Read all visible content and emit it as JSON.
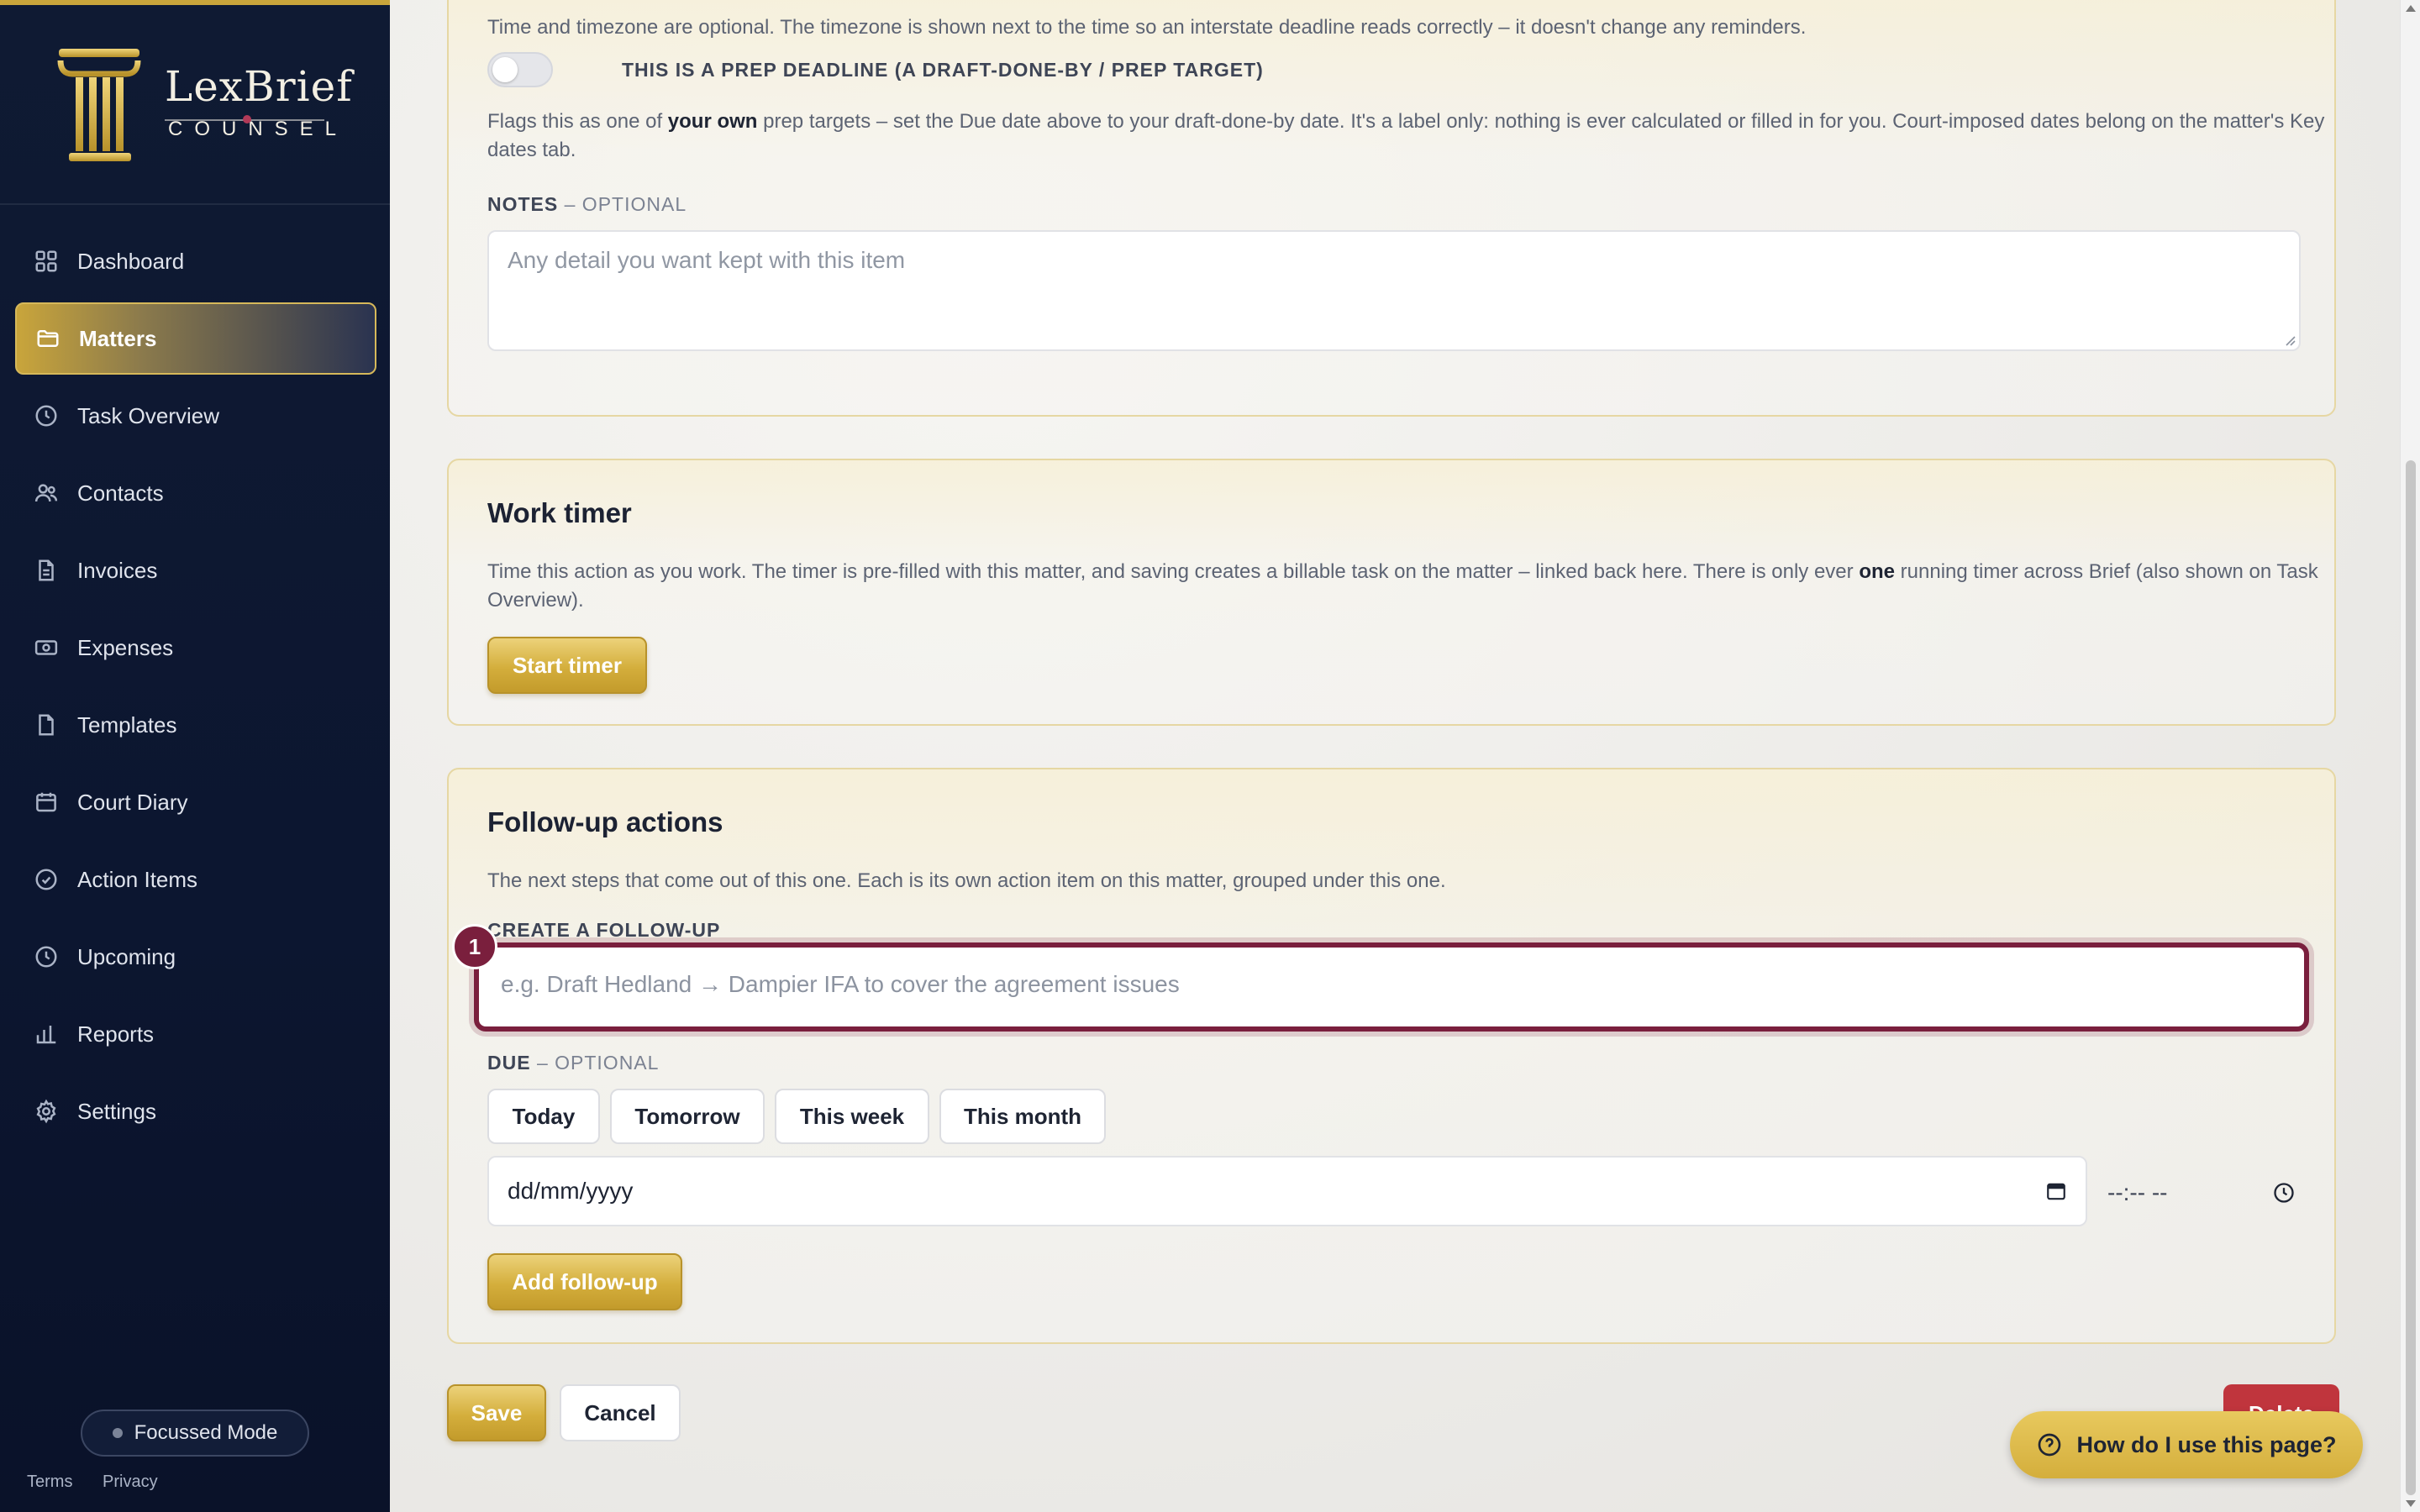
{
  "app": {
    "logo_name": "LexBrief",
    "logo_sub": "COUNSEL"
  },
  "sidebar": {
    "items": [
      {
        "label": "Dashboard",
        "icon": "grid-icon"
      },
      {
        "label": "Matters",
        "icon": "folder-icon",
        "active": true
      },
      {
        "label": "Task Overview",
        "icon": "clock-icon"
      },
      {
        "label": "Contacts",
        "icon": "users-icon"
      },
      {
        "label": "Invoices",
        "icon": "file-icon"
      },
      {
        "label": "Expenses",
        "icon": "banknote-icon"
      },
      {
        "label": "Templates",
        "icon": "file-icon"
      },
      {
        "label": "Court Diary",
        "icon": "calendar-icon"
      },
      {
        "label": "Action Items",
        "icon": "check-circle-icon"
      },
      {
        "label": "Upcoming",
        "icon": "clock-icon"
      },
      {
        "label": "Reports",
        "icon": "bar-chart-icon"
      },
      {
        "label": "Settings",
        "icon": "gear-icon"
      }
    ],
    "focus_mode": "Focussed Mode",
    "footer": {
      "terms": "Terms",
      "privacy": "Privacy"
    }
  },
  "deadline_card": {
    "timezone_note": "Time and timezone are optional. The timezone is shown next to the time so an interstate deadline reads correctly – it doesn't change any reminders.",
    "prep_toggle_label": "THIS IS A PREP DEADLINE (A DRAFT-DONE-BY / PREP TARGET)",
    "prep_help_1": "Flags this as one of ",
    "prep_help_bold": "your own",
    "prep_help_2": " prep targets – set the Due date above to your draft-done-by date. It's a label only: nothing is ever calculated or filled in for you. Court-imposed dates belong on the matter's Key dates tab.",
    "notes_label": "NOTES",
    "notes_optional": " – OPTIONAL",
    "notes_placeholder": "Any detail you want kept with this item"
  },
  "timer_card": {
    "title": "Work timer",
    "desc_1": "Time this action as you work. The timer is pre-filled with this matter, and saving creates a billable task on the matter – linked back here. There is only ever ",
    "desc_bold": "one",
    "desc_2": " running timer across Brief (also shown on Task Overview).",
    "start_button": "Start timer"
  },
  "followup_card": {
    "title": "Follow-up actions",
    "desc": "The next steps that come out of this one. Each is its own action item on this matter, grouped under this one.",
    "create_label": "CREATE A FOLLOW-UP",
    "step_badge": "1",
    "input_placeholder": "e.g. Draft Hedland → Dampier IFA to cover the agreement issues",
    "due_label": "DUE",
    "due_optional": " – OPTIONAL",
    "quick_dates": [
      "Today",
      "Tomorrow",
      "This week",
      "This month"
    ],
    "date_placeholder": "dd/mm/yyyy",
    "time_placeholder": "--:-- --",
    "add_button": "Add follow-up"
  },
  "footer_actions": {
    "save": "Save",
    "cancel": "Cancel",
    "delete": "Delete"
  },
  "help": {
    "label": "How do I use this page?"
  },
  "colors": {
    "sidebar_bg": "#0f1a33",
    "gold": "#d4ae3c",
    "focus_ring": "#7a1f3d",
    "delete": "#c0353d"
  }
}
